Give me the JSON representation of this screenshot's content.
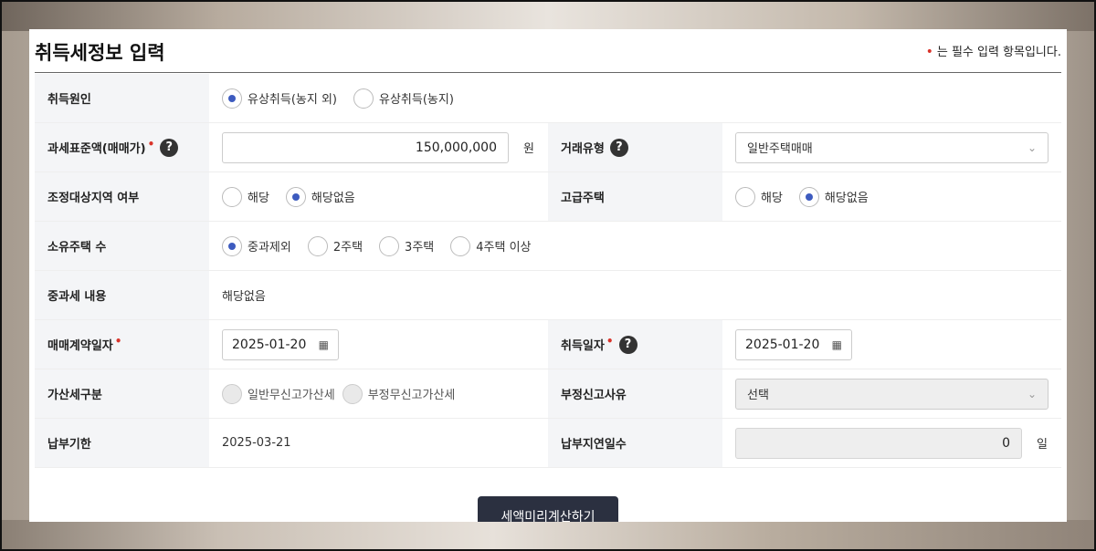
{
  "header": {
    "title": "취득세정보 입력",
    "required_note_dot": "•",
    "required_note": "는 필수 입력 항목입니다."
  },
  "rows": {
    "cause": {
      "label": "취득원인",
      "options": [
        "유상취득(농지 외)",
        "유상취득(농지)"
      ],
      "selected": 0
    },
    "tax_base": {
      "label": "과세표준액(매매가)",
      "value": "150,000,000",
      "unit": "원"
    },
    "trade_type": {
      "label": "거래유형",
      "value": "일반주택매매"
    },
    "adjust_area": {
      "label": "조정대상지역 여부",
      "options": [
        "해당",
        "해당없음"
      ],
      "selected": 1
    },
    "luxury": {
      "label": "고급주택",
      "options": [
        "해당",
        "해당없음"
      ],
      "selected": 1
    },
    "own_count": {
      "label": "소유주택 수",
      "options": [
        "중과제외",
        "2주택",
        "3주택",
        "4주택 이상"
      ],
      "selected": 0
    },
    "heavy_tax": {
      "label": "중과세 내용",
      "value": "해당없음"
    },
    "contract_date": {
      "label": "매매계약일자",
      "value": "2025-01-20"
    },
    "acq_date": {
      "label": "취득일자",
      "value": "2025-01-20"
    },
    "penalty_type": {
      "label": "가산세구분",
      "options": [
        "일반무신고가산세",
        "부정무신고가산세"
      ]
    },
    "fraud_reason": {
      "label": "부정신고사유",
      "value": "선택"
    },
    "due_date": {
      "label": "납부기한",
      "value": "2025-03-21"
    },
    "delay_days": {
      "label": "납부지연일수",
      "value": "0",
      "unit": "일"
    }
  },
  "icons": {
    "help": "?",
    "calendar": "calendar-icon",
    "chevron": "chevron-down-icon"
  },
  "colors": {
    "accent": "#3d5bbf",
    "required": "#d9342b",
    "button": "#2b3040"
  },
  "button": {
    "calc_label": "세액미리계산하기"
  }
}
